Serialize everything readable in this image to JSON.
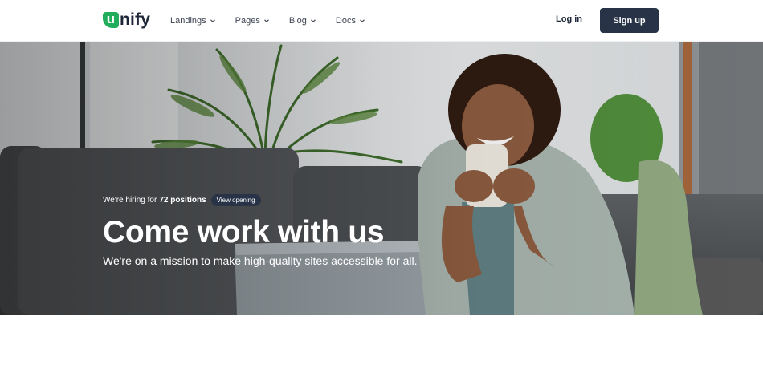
{
  "brand": {
    "logo_letter": "u",
    "logo_rest": "nify",
    "accent": "#21ad5c",
    "dark": "#283347"
  },
  "nav": [
    {
      "label": "Landings"
    },
    {
      "label": "Pages"
    },
    {
      "label": "Blog"
    },
    {
      "label": "Docs"
    }
  ],
  "header": {
    "login_label": "Log in",
    "signup_label": "Sign up"
  },
  "hero": {
    "hiring_prefix": "We're hiring for",
    "hiring_count": "72 positions",
    "view_label": "View opening",
    "title": "Come work with us",
    "subtitle": "We're on a mission to make high-quality sites accessible for all."
  },
  "icons": {
    "nav_chevron": "chevron-down-icon"
  }
}
